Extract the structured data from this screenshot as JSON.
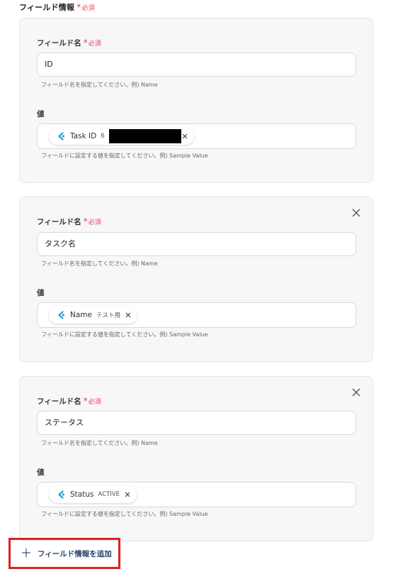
{
  "section": {
    "title": "フィールド情報",
    "required_label": "必須"
  },
  "cards": [
    {
      "field_label": "フィールド名",
      "required_label": "必須",
      "name_value": "ID",
      "name_help": "フィールド名を指定してください。例) Name",
      "value_label": "値",
      "chip_name": "Task ID",
      "chip_sample": "6",
      "value_help": "フィールドに設定する値を指定してください。例) Sample Value",
      "closable": false
    },
    {
      "field_label": "フィールド名",
      "required_label": "必須",
      "name_value": "タスク名",
      "name_help": "フィールド名を指定してください。例) Name",
      "value_label": "値",
      "chip_name": "Name",
      "chip_sample": "テスト用",
      "value_help": "フィールドに設定する値を指定してください。例) Sample Value",
      "closable": true
    },
    {
      "field_label": "フィールド名",
      "required_label": "必須",
      "name_value": "ステータス",
      "name_help": "フィールド名を指定してください。例) Name",
      "value_label": "値",
      "chip_name": "Status",
      "chip_sample": "ACTIVE",
      "value_help": "フィールドに設定する値を指定してください。例) Sample Value",
      "closable": true
    }
  ],
  "add_button": {
    "label": "フィールド情報を追加",
    "icon": "plus-icon"
  },
  "colors": {
    "required": "#e0445a",
    "highlight_border": "#e0201e",
    "add_button_text": "#23456a",
    "chip_icon": "#2aa0d8"
  }
}
